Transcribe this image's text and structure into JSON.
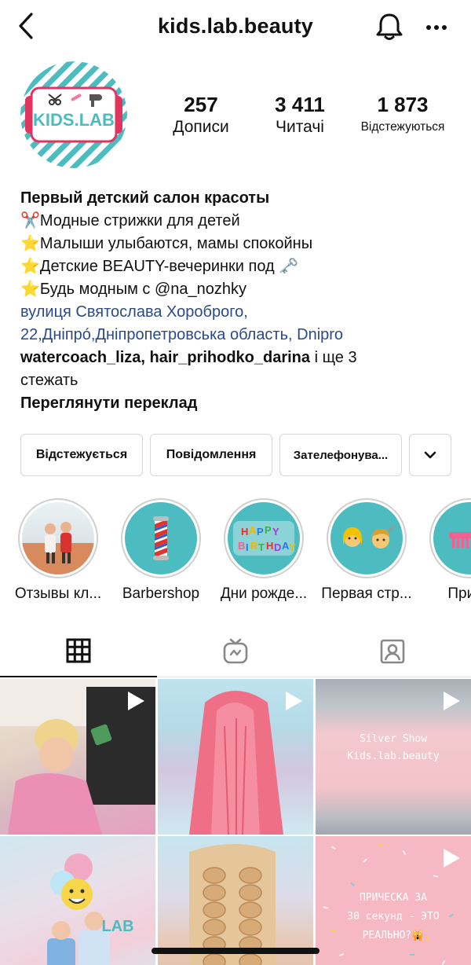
{
  "header": {
    "username": "kids.lab.beauty",
    "icons": {
      "back": "chevron-left-icon",
      "bell": "bell-icon",
      "more": "more-dots-icon"
    }
  },
  "profile": {
    "avatar_text": "KIDS.LAB",
    "stats": [
      {
        "value": "257",
        "label": "Дописи"
      },
      {
        "value": "3 411",
        "label": "Читачі"
      },
      {
        "value": "1 873",
        "label": "Відстежуються"
      }
    ]
  },
  "bio": {
    "name": "Первый детский салон красоты",
    "lines": [
      "✂️Модные стрижки для детей",
      "⭐Малыши улыбаются, мамы спокойны",
      "⭐Детские BEAUTY-вечеринки под 🗝️",
      "⭐Будь модным с @na_nozhky"
    ],
    "address_line1": "вулиця Святослава Хороброго,",
    "address_line2": "22,Дніпро́,Дніпропетровська область, Dnipro",
    "followed_by_names": "watercoach_liza, hair_prihodko_darina",
    "followed_by_rest": " і ще 3",
    "followed_by_line2": "стежать",
    "translate": "Переглянути переклад"
  },
  "actions": {
    "following": "Відстежується",
    "message": "Повідомлення",
    "call": "Зателефонува..."
  },
  "highlights": [
    {
      "label": "Отзывы кл..."
    },
    {
      "label": "Barbershop"
    },
    {
      "label": "Дни рожде..."
    },
    {
      "label": "Первая стр..."
    },
    {
      "label": "Приче"
    }
  ],
  "tabs": [
    {
      "icon": "grid-icon",
      "active": true
    },
    {
      "icon": "igtv-icon",
      "active": false
    },
    {
      "icon": "tagged-icon",
      "active": false
    }
  ],
  "posts": {
    "p3_line1": "Silver Show",
    "p3_line2": "Kids.lab.beauty",
    "p6_line1": "ПРИЧЕСКА ЗА",
    "p6_line2": "30 секунд - ЭТО",
    "p6_line3": "РЕАЛЬНО?🙀",
    "p4_logo": "LAB"
  },
  "colors": {
    "teal": "#4dbcc1",
    "link": "#2b4a86",
    "pink": "#e75a8a"
  }
}
